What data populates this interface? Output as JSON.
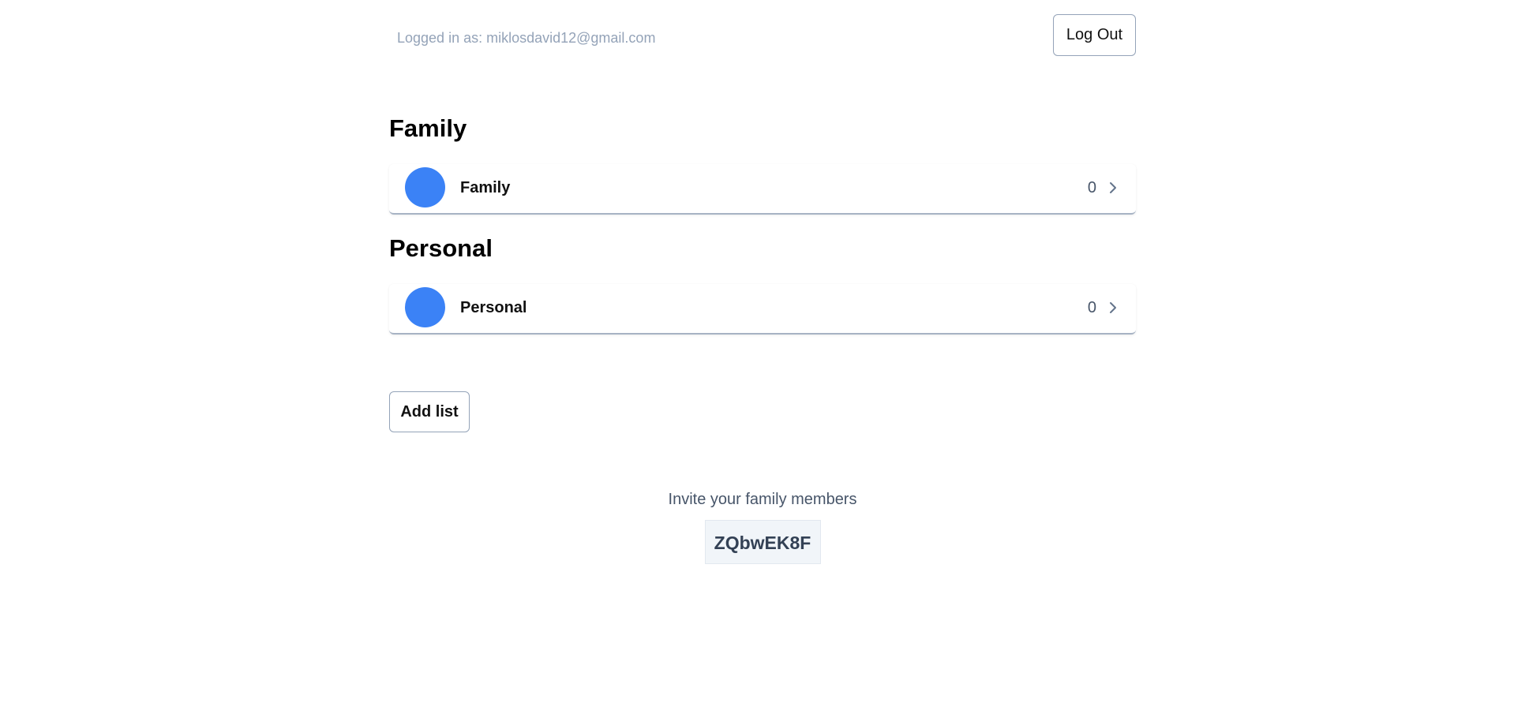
{
  "header": {
    "logged_in_text": "Logged in as: miklosdavid12@gmail.com",
    "logout_label": "Log Out"
  },
  "sections": [
    {
      "title": "Family",
      "lists": [
        {
          "name": "Family",
          "count": "0",
          "color": "#3b82f6"
        }
      ]
    },
    {
      "title": "Personal",
      "lists": [
        {
          "name": "Personal",
          "count": "0",
          "color": "#3b82f6"
        }
      ]
    }
  ],
  "actions": {
    "add_list_label": "Add list"
  },
  "invite": {
    "text": "Invite your family members",
    "code": "ZQbwEK8F"
  },
  "icons": {
    "chevron": "chevron-right-icon"
  }
}
